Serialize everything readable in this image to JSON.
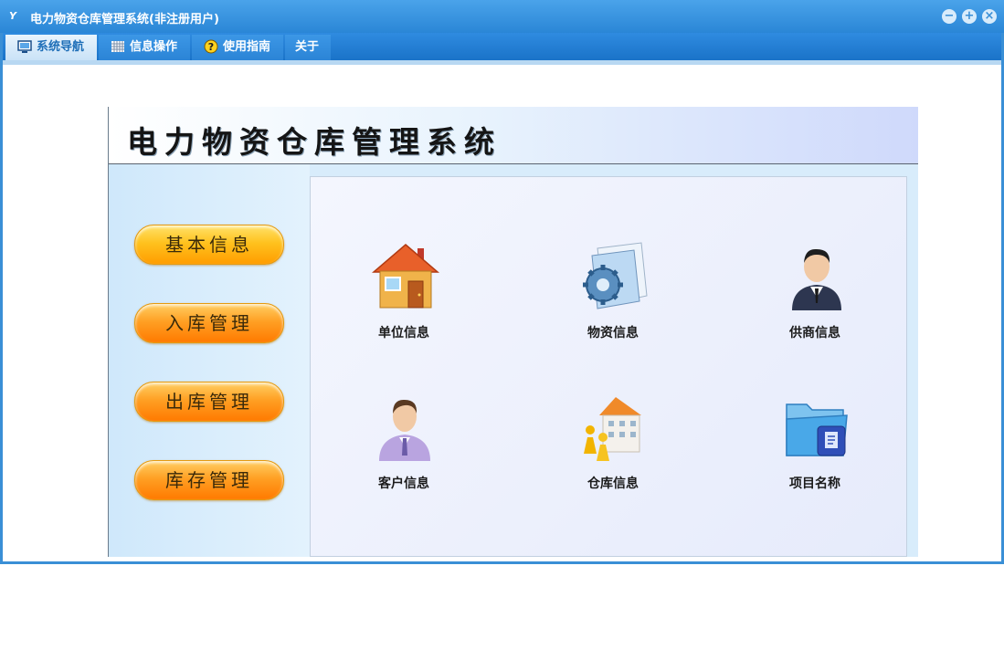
{
  "window": {
    "title": "电力物资仓库管理系统(非注册用户)",
    "app_icon": "Y"
  },
  "menu": {
    "tabs": [
      {
        "label": "系统导航",
        "icon": "monitor-icon",
        "active": true
      },
      {
        "label": "信息操作",
        "icon": "grid-icon",
        "active": false
      },
      {
        "label": "使用指南",
        "icon": "help-icon",
        "active": false
      },
      {
        "label": "关于",
        "icon": "",
        "active": false
      }
    ]
  },
  "panel": {
    "title": "电力物资仓库管理系统"
  },
  "sidebar": {
    "buttons": [
      {
        "label": "基本信息"
      },
      {
        "label": "入库管理"
      },
      {
        "label": "出库管理"
      },
      {
        "label": "库存管理"
      }
    ]
  },
  "tiles": [
    {
      "label": "单位信息",
      "icon": "house-icon"
    },
    {
      "label": "物资信息",
      "icon": "gear-folder-icon"
    },
    {
      "label": "供商信息",
      "icon": "businessman-icon"
    },
    {
      "label": "客户信息",
      "icon": "customer-icon"
    },
    {
      "label": "仓库信息",
      "icon": "warehouse-icon"
    },
    {
      "label": "项目名称",
      "icon": "folder-icon"
    }
  ],
  "colors": {
    "titlebar": "#2a86d6",
    "accent": "#1a73c8",
    "button": "#ffc21e"
  }
}
